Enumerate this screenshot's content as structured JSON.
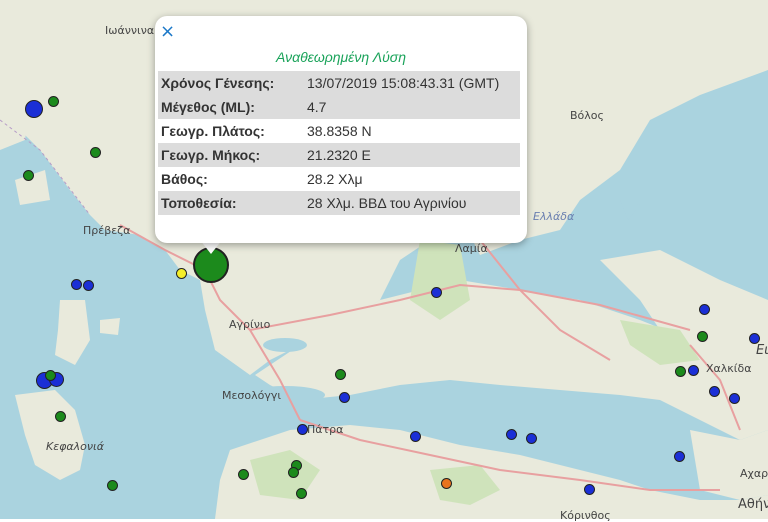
{
  "map": {
    "colors": {
      "sea": "#aad3df",
      "land": "#e9eadc",
      "forest": "#cfe3bb",
      "roads": "#e8a0a0"
    },
    "places": [
      {
        "id": "ioannina",
        "label": "Ιωάννινα"
      },
      {
        "id": "volos",
        "label": "Βόλος"
      },
      {
        "id": "preveza",
        "label": "Πρέβεζα"
      },
      {
        "id": "agrinio",
        "label": "Αγρίνιο"
      },
      {
        "id": "mesolongi",
        "label": "Μεσολόγγι"
      },
      {
        "id": "patra",
        "label": "Πάτρα"
      },
      {
        "id": "kefalonia",
        "label": "Κεφαλονιά"
      },
      {
        "id": "chalkida",
        "label": "Χαλκίδα"
      },
      {
        "id": "lamia",
        "label": "Λαμία"
      },
      {
        "id": "acharnes",
        "label": "Αχαρ"
      },
      {
        "id": "athens",
        "label": "Αθήν"
      },
      {
        "id": "korinthos",
        "label": "Κόρινθος"
      },
      {
        "id": "ellada",
        "label": "Ελλάδα"
      },
      {
        "id": "evia",
        "label": "Ευ"
      }
    ],
    "quake_colors": {
      "green": "#1c8a1c",
      "blue": "#1b2fd6",
      "yellow": "#f4ee2a",
      "orange": "#e8731e"
    }
  },
  "popup": {
    "close_icon": "×",
    "title": "Αναθεωρημένη Λύση",
    "rows": [
      {
        "label": "Χρόνος Γένεσης:",
        "value": "13/07/2019 15:08:43.31 (GMT)"
      },
      {
        "label": "Μέγεθος (ML):",
        "value": "4.7"
      },
      {
        "label": "Γεωγρ. Πλάτος:",
        "value": "38.8358 N"
      },
      {
        "label": "Γεωγρ. Μήκος:",
        "value": "21.2320 E"
      },
      {
        "label": "Βάθος:",
        "value": "28.2 Χλμ"
      },
      {
        "label": "Τοποθεσία:",
        "value": "28 Χλμ. ΒΒΔ του Αγρινίου"
      }
    ]
  }
}
